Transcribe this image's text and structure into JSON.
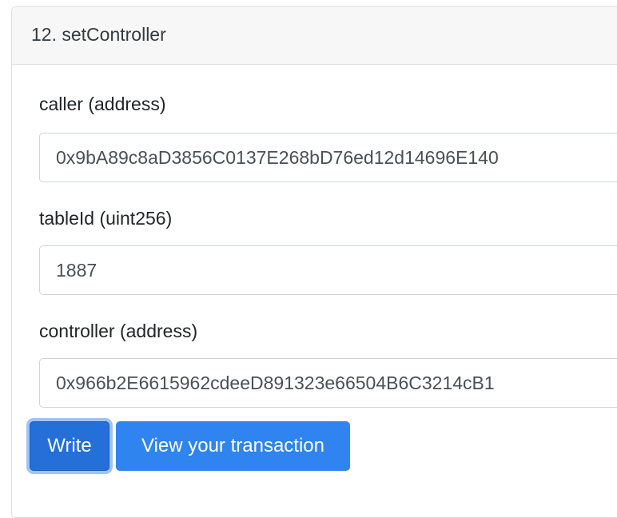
{
  "card": {
    "title": "12. setController"
  },
  "fields": [
    {
      "label": "caller (address)",
      "value": "0x9bA89c8aD3856C0137E268bD76ed12d14696E140"
    },
    {
      "label": "tableId (uint256)",
      "value": "1887"
    },
    {
      "label": "controller (address)",
      "value": "0x966b2E6615962cdeeD891323e66504B6C3214cB1"
    }
  ],
  "buttons": {
    "write_label": "Write",
    "view_label": "View your transaction"
  },
  "colors": {
    "primary": "#2f84f0",
    "primary_active": "#2470d8",
    "header_bg": "#f7f7f7",
    "border": "#dcdfe3"
  }
}
